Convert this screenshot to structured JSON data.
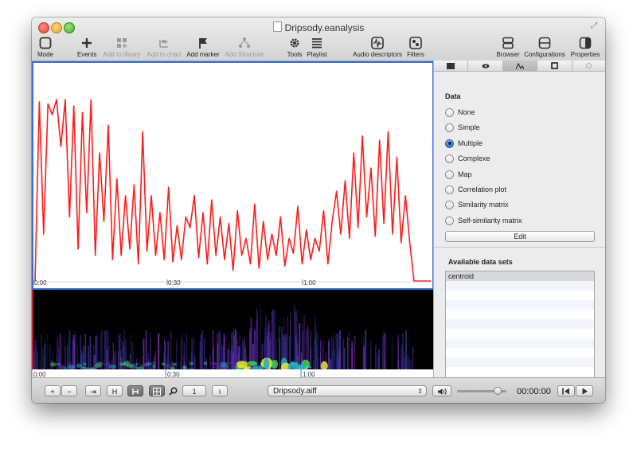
{
  "window": {
    "title": "Dripsody.eanalysis"
  },
  "toolbar": {
    "items": [
      {
        "label": "Mode",
        "icon": "square-icon",
        "enabled": true
      },
      {
        "label": "Events",
        "icon": "plus-icon",
        "enabled": true
      },
      {
        "label": "Add to library",
        "icon": "library-add-icon",
        "enabled": false
      },
      {
        "label": "Add to chart",
        "icon": "chart-add-icon",
        "enabled": false
      },
      {
        "label": "Add marker",
        "icon": "flag-icon",
        "enabled": true
      },
      {
        "label": "Add Structure",
        "icon": "structure-add-icon",
        "enabled": false
      },
      {
        "label": "Tools",
        "icon": "gear-icon",
        "enabled": true
      },
      {
        "label": "Playlist",
        "icon": "list-icon",
        "enabled": true
      },
      {
        "label": "Audio descriptors",
        "icon": "waveform-icon",
        "enabled": true
      },
      {
        "label": "Filters",
        "icon": "filter-icon",
        "enabled": true
      },
      {
        "label": "Browser",
        "icon": "browser-icon",
        "enabled": true
      },
      {
        "label": "Configurations",
        "icon": "configurations-icon",
        "enabled": true
      },
      {
        "label": "Properties",
        "icon": "properties-icon",
        "enabled": true
      }
    ]
  },
  "timeline": {
    "ticks": [
      "0:00",
      "0:30",
      "1:00"
    ]
  },
  "chart_data": {
    "type": "line",
    "title": "",
    "xlabel": "",
    "ylabel": "",
    "x_ticks": [
      "0:00",
      "0:30",
      "1:00"
    ],
    "xlim": [
      0,
      89
    ],
    "ylim": [
      0,
      1
    ],
    "series": [
      {
        "color": "#ff1a1a",
        "values": [
          0,
          0.84,
          0.22,
          0.83,
          0.78,
          0.85,
          0.63,
          0.85,
          0.3,
          0.82,
          0.15,
          0.79,
          0.32,
          0.85,
          0.12,
          0.6,
          0.28,
          0.73,
          0.1,
          0.48,
          0.12,
          0.4,
          0.15,
          0.45,
          0.08,
          0.7,
          0.14,
          0.4,
          0.12,
          0.32,
          0.1,
          0.44,
          0.09,
          0.26,
          0.1,
          0.3,
          0.25,
          0.4,
          0.11,
          0.32,
          0.08,
          0.38,
          0.12,
          0.3,
          0.1,
          0.27,
          0.05,
          0.33,
          0.12,
          0.2,
          0.08,
          0.36,
          0.06,
          0.28,
          0.1,
          0.22,
          0.12,
          0.3,
          0.07,
          0.2,
          0.13,
          0.35,
          0.08,
          0.24,
          0.1,
          0.2,
          0.14,
          0.33,
          0.08,
          0.28,
          0.42,
          0.22,
          0.47,
          0.2,
          0.6,
          0.25,
          0.68,
          0.3,
          0.53,
          0.21,
          0.66,
          0.27,
          0.7,
          0.22,
          0.58,
          0.18,
          0.4,
          0.18,
          0
        ]
      }
    ],
    "grid": false,
    "legend": "none"
  },
  "spectrogram": {
    "label": "spectrogram",
    "ticks": [
      "0:00",
      "0:30",
      "1:00"
    ]
  },
  "inspector": {
    "tabs": [
      "table-tab",
      "eye-tab",
      "curve-tab",
      "square-tab",
      "gear-tab"
    ],
    "data_heading": "Data",
    "options": [
      "None",
      "Simple",
      "Multiple",
      "Complexe",
      "Map",
      "Correlation plot",
      "Similarity matrix",
      "Self-similarity matrix"
    ],
    "selected": "Multiple",
    "edit_label": "Edit",
    "datasets_heading": "Available data sets",
    "datasets": [
      "centroid"
    ]
  },
  "bottombar": {
    "plus_label": "+",
    "minus_label": "−",
    "jump_label": "⇥",
    "h_label": "H",
    "page_value": "1",
    "info_label": "i",
    "file_name": "Dripsody.aiff",
    "volume_fraction": 0.82,
    "timecode": "00:00:00"
  },
  "colors": {
    "accent": "#3a6fd8",
    "curve": "#ff1a1a"
  }
}
